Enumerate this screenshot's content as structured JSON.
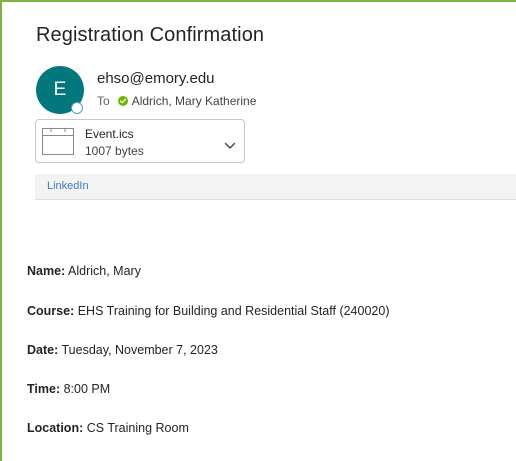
{
  "email": {
    "subject": "Registration Confirmation",
    "avatar_initial": "E",
    "sender": "ehso@emory.edu",
    "to_label": "To",
    "recipient": "Aldrich, Mary Katherine"
  },
  "attachment": {
    "name": "Event.ics",
    "size": "1007 bytes"
  },
  "links": {
    "linkedin": "LinkedIn"
  },
  "body": {
    "name_label": "Name:",
    "name_value": "Aldrich, Mary",
    "course_label": "Course:",
    "course_value": "EHS Training for Building and Residential Staff (240020)",
    "date_label": "Date:",
    "date_value": "Tuesday, November 7, 2023",
    "time_label": "Time:",
    "time_value": "8:00 PM",
    "location_label": "Location:",
    "location_value": "CS Training Room"
  },
  "colors": {
    "avatar": "#03787c",
    "frame_border": "#7cb342",
    "presence_ok": "#6bb700",
    "link": "#3a7bc8"
  }
}
